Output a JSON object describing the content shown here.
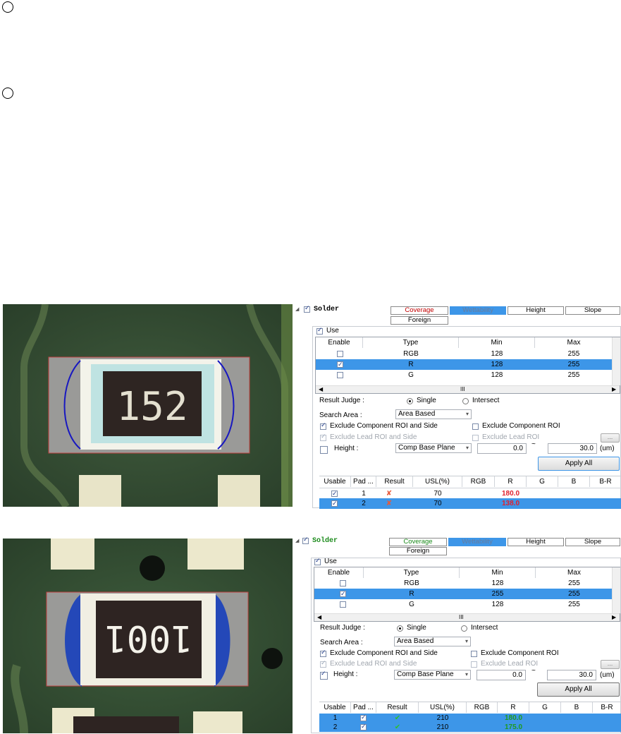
{
  "panels": [
    {
      "section_title": "Solder",
      "section_title_color": "#c00000",
      "tabs": [
        "Coverage",
        "Wettability",
        "Height",
        "Slope",
        "Foreign"
      ],
      "active_tab": "Wettability",
      "use_label": "Use",
      "grid_headers": [
        "Enable",
        "Type",
        "Min",
        "Max"
      ],
      "grid_rows": [
        {
          "type": "RGB",
          "min": "128",
          "max": "255",
          "checked": false,
          "selected": false
        },
        {
          "type": "R",
          "min": "128",
          "max": "255",
          "checked": true,
          "selected": true
        },
        {
          "type": "G",
          "min": "128",
          "max": "255",
          "checked": false,
          "selected": false
        }
      ],
      "scroll_glyph": "III",
      "result_judge_label": "Result Judge :",
      "single_label": "Single",
      "intersect_label": "Intersect",
      "search_area_label": "Search Area :",
      "search_area_value": "Area Based",
      "exclude_comp_side": "Exclude Component ROI and Side",
      "exclude_comp": "Exclude Component ROI",
      "exclude_lead_side": "Exclude Lead  ROI and Side",
      "exclude_lead": "Exclude Lead  ROI",
      "ellipsis": "...",
      "height_label": "Height :",
      "height_checked": false,
      "plane_value": "Comp Base Plane",
      "range_min": "0.0",
      "tilde": "~",
      "range_max": "30.0",
      "unit": "(um)",
      "apply_all": "Apply All",
      "result_headers": [
        "Usable",
        "Pad ...",
        "Result",
        "USL(%)",
        "RGB",
        "R",
        "G",
        "B",
        "B-R"
      ],
      "result_rows": [
        {
          "pad": "1",
          "usl": "70",
          "r": "180.0",
          "pass": false,
          "selected": false
        },
        {
          "pad": "2",
          "usl": "70",
          "r": "138.0",
          "pass": false,
          "selected": true
        }
      ],
      "photo_marking": "152"
    },
    {
      "section_title": "Solder",
      "section_title_color": "#1a8a1a",
      "tabs": [
        "Coverage",
        "Wettability",
        "Height",
        "Slope",
        "Foreign"
      ],
      "active_tab": "Wettability",
      "use_label": "Use",
      "grid_headers": [
        "Enable",
        "Type",
        "Min",
        "Max"
      ],
      "grid_rows": [
        {
          "type": "RGB",
          "min": "128",
          "max": "255",
          "checked": false,
          "selected": false
        },
        {
          "type": "R",
          "min": "255",
          "max": "255",
          "checked": true,
          "selected": true
        },
        {
          "type": "G",
          "min": "128",
          "max": "255",
          "checked": false,
          "selected": false
        }
      ],
      "scroll_glyph": "III",
      "result_judge_label": "Result Judge :",
      "single_label": "Single",
      "intersect_label": "Intersect",
      "search_area_label": "Search Area :",
      "search_area_value": "Area Based",
      "exclude_comp_side": "Exclude Component ROI and Side",
      "exclude_comp": "Exclude Component ROI",
      "exclude_lead_side": "Exclude Lead  ROI and Side",
      "exclude_lead": "Exclude Lead  ROI",
      "ellipsis": "...",
      "height_label": "Height :",
      "height_checked": true,
      "plane_value": "Comp Base Plane",
      "range_min": "0.0",
      "tilde": "~",
      "range_max": "30.0",
      "unit": "(um)",
      "apply_all": "Apply All",
      "result_headers": [
        "Usable",
        "Pad ...",
        "Result",
        "USL(%)",
        "RGB",
        "R",
        "G",
        "B",
        "B-R"
      ],
      "result_rows": [
        {
          "pad": "1",
          "usl": "210",
          "r": "180.0",
          "pass": true,
          "selected": true
        },
        {
          "pad": "2",
          "usl": "210",
          "r": "175.0",
          "pass": true,
          "selected": true
        }
      ],
      "photo_marking": "1001"
    }
  ]
}
